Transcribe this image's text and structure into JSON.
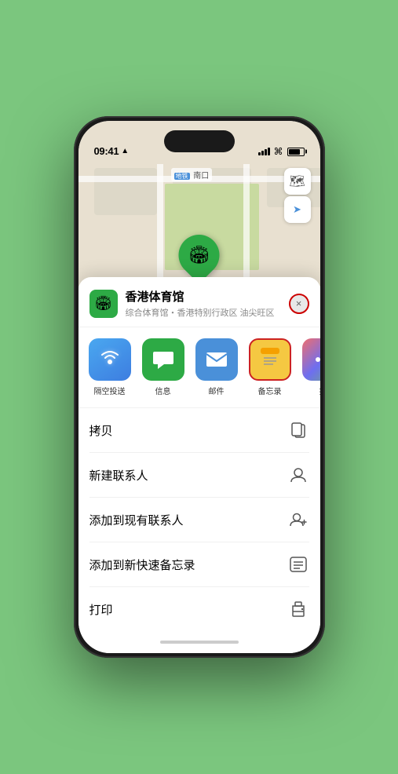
{
  "status_bar": {
    "time": "09:41",
    "location_arrow": "▲"
  },
  "map": {
    "label": "南口",
    "marker_emoji": "🏟",
    "marker_label": "香港体育馆"
  },
  "map_controls": {
    "map_type_icon": "🗺",
    "location_icon": "➤"
  },
  "location_card": {
    "icon_emoji": "🏟",
    "name": "香港体育馆",
    "description": "综合体育馆・香港特别行政区 油尖旺区",
    "close_label": "×"
  },
  "share_items": [
    {
      "id": "airdrop",
      "icon": "📡",
      "label": "隔空投送",
      "style": "airdrop"
    },
    {
      "id": "message",
      "icon": "💬",
      "label": "信息",
      "style": "message"
    },
    {
      "id": "mail",
      "icon": "✉️",
      "label": "邮件",
      "style": "mail"
    },
    {
      "id": "notes",
      "icon": "📝",
      "label": "备忘录",
      "style": "notes"
    },
    {
      "id": "more",
      "icon": "⋯",
      "label": "推",
      "style": "more"
    }
  ],
  "actions": [
    {
      "id": "copy",
      "label": "拷贝",
      "icon": "⧉"
    },
    {
      "id": "new-contact",
      "label": "新建联系人",
      "icon": "👤"
    },
    {
      "id": "add-existing",
      "label": "添加到现有联系人",
      "icon": "👥"
    },
    {
      "id": "add-notes",
      "label": "添加到新快速备忘录",
      "icon": "📋"
    },
    {
      "id": "print",
      "label": "打印",
      "icon": "🖨"
    }
  ],
  "colors": {
    "green": "#2daa45",
    "blue": "#4a90d9",
    "yellow": "#f5c842",
    "red": "#cc2222",
    "bg": "#7bc67e"
  }
}
